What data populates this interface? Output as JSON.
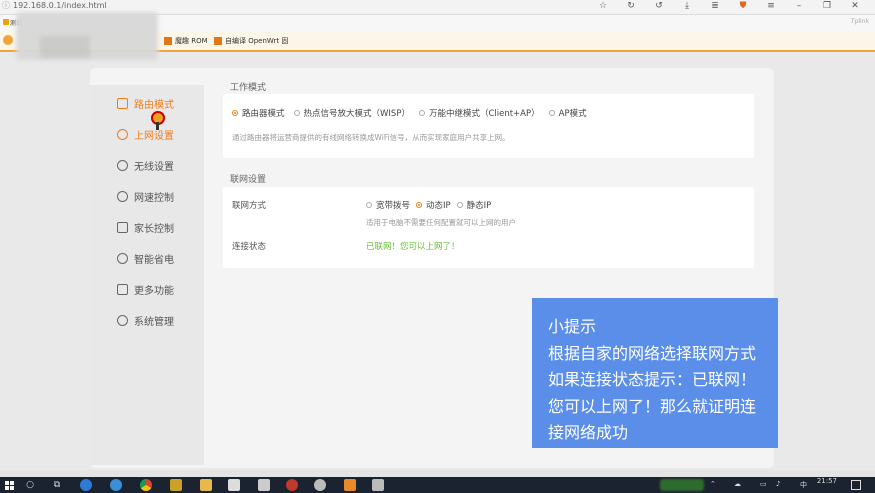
{
  "browser": {
    "url": "192.168.0.1/index.html",
    "tab_title": "测试",
    "brand": "Tplink",
    "bookmarks": [
      {
        "label": "魔趣 ROM"
      },
      {
        "label": "自编译 OpenWrt 固"
      }
    ],
    "toolbar_icons": [
      "star-icon",
      "refresh-icon",
      "undo-icon",
      "download-icon",
      "menu-icon",
      "shield-icon",
      "list-icon",
      "minimize-icon",
      "restore-icon",
      "close-icon"
    ]
  },
  "sidebar": {
    "items": [
      {
        "label": "路由模式",
        "icon": "router-icon",
        "active": true
      },
      {
        "label": "上网设置",
        "icon": "globe-icon",
        "active": true
      },
      {
        "label": "无线设置",
        "icon": "wifi-icon",
        "active": false
      },
      {
        "label": "网速控制",
        "icon": "speed-icon",
        "active": false
      },
      {
        "label": "家长控制",
        "icon": "home-icon",
        "active": false
      },
      {
        "label": "智能省电",
        "icon": "power-icon",
        "active": false
      },
      {
        "label": "更多功能",
        "icon": "grid-icon",
        "active": false
      },
      {
        "label": "系统管理",
        "icon": "settings-icon",
        "active": false
      }
    ]
  },
  "work_mode": {
    "title": "工作模式",
    "options": [
      {
        "label": "路由器模式",
        "selected": true
      },
      {
        "label": "热点信号放大模式（WISP）",
        "selected": false
      },
      {
        "label": "万能中继模式（Client+AP）",
        "selected": false
      },
      {
        "label": "AP模式",
        "selected": false
      }
    ],
    "description": "通过路由器将运营商提供的有线网络转换成WiFi信号，从而实现家庭用户共享上网。"
  },
  "network": {
    "title": "联网设置",
    "method_label": "联网方式",
    "methods": [
      {
        "label": "宽带拨号",
        "selected": false
      },
      {
        "label": "动态IP",
        "selected": true
      },
      {
        "label": "静态IP",
        "selected": false
      }
    ],
    "method_hint": "适用于电脑不需要任何配置就可以上网的用户",
    "status_label": "连接状态",
    "status_value": "已联网！您可以上网了！"
  },
  "tip": {
    "lines": [
      "小提示",
      "根据自家的网络选择联网方式",
      "如果连接状态提示：已联网！",
      "您可以上网了！那么就证明连",
      "接网络成功"
    ]
  },
  "taskbar": {
    "time": "21:57",
    "ime": "中",
    "apps": [
      "search-icon",
      "task-view-icon",
      "edge-icon",
      "browser-icon",
      "chrome-icon",
      "app-star-icon",
      "folder-icon",
      "store-icon",
      "mail-icon",
      "record-icon",
      "media-icon",
      "headphones-icon",
      "photos-icon"
    ]
  },
  "colors": {
    "accent": "#ef7d1c",
    "success": "#6bbf3a",
    "tip_bg": "#5b8ee8",
    "taskbar": "#1c2330"
  }
}
